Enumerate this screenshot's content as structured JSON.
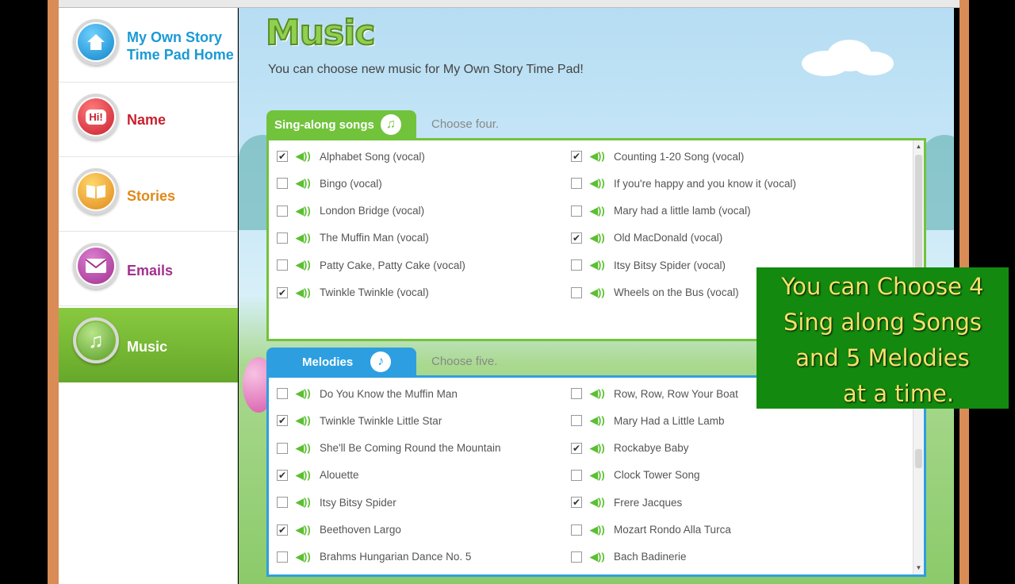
{
  "sidebar": {
    "items": [
      {
        "label_line1": "My Own Story",
        "label_line2": "Time Pad Home",
        "icon": "home-icon",
        "color": "#1a9ad6"
      },
      {
        "label": "Name",
        "icon": "hi-speech-icon",
        "icon_text": "Hi!",
        "color": "#c8202e"
      },
      {
        "label": "Stories",
        "icon": "book-icon",
        "color": "#e08a1a"
      },
      {
        "label": "Emails",
        "icon": "envelope-icon",
        "color": "#a2318f"
      },
      {
        "label": "Music",
        "icon": "music-note-icon",
        "color": "#ffffff",
        "active": true
      }
    ]
  },
  "main": {
    "title": "Music",
    "subtitle": "You can choose new music for My Own Story Time Pad!"
  },
  "sing_along": {
    "tab_label": "Sing-along songs",
    "choose_text": "Choose four.",
    "left": [
      {
        "label": "Alphabet Song (vocal)",
        "checked": true
      },
      {
        "label": "Bingo (vocal)",
        "checked": false
      },
      {
        "label": "London Bridge (vocal)",
        "checked": false
      },
      {
        "label": "The Muffin Man (vocal)",
        "checked": false
      },
      {
        "label": "Patty Cake, Patty Cake (vocal)",
        "checked": false
      },
      {
        "label": "Twinkle Twinkle (vocal)",
        "checked": true
      }
    ],
    "right": [
      {
        "label": "Counting 1-20 Song (vocal)",
        "checked": true
      },
      {
        "label": "If you're happy and you know it (vocal)",
        "checked": false
      },
      {
        "label": "Mary had a little lamb (vocal)",
        "checked": false
      },
      {
        "label": "Old MacDonald (vocal)",
        "checked": true
      },
      {
        "label": "Itsy Bitsy Spider (vocal)",
        "checked": false
      },
      {
        "label": "Wheels on the Bus (vocal)",
        "checked": false
      }
    ]
  },
  "melodies": {
    "tab_label": "Melodies",
    "choose_text": "Choose five.",
    "left": [
      {
        "label": "Do You Know the Muffin Man",
        "checked": false
      },
      {
        "label": "Twinkle Twinkle Little Star",
        "checked": true
      },
      {
        "label": "She'll Be Coming Round the Mountain",
        "checked": false
      },
      {
        "label": "Alouette",
        "checked": true
      },
      {
        "label": "Itsy Bitsy Spider",
        "checked": false
      },
      {
        "label": "Beethoven Largo",
        "checked": true
      },
      {
        "label": "Brahms Hungarian Dance No. 5",
        "checked": false
      }
    ],
    "right": [
      {
        "label": "Row, Row, Row Your Boat",
        "checked": false
      },
      {
        "label": "Mary Had a Little Lamb",
        "checked": false
      },
      {
        "label": "Rockabye Baby",
        "checked": true
      },
      {
        "label": "Clock Tower Song",
        "checked": false
      },
      {
        "label": "Frere Jacques",
        "checked": true
      },
      {
        "label": "Mozart Rondo Alla Turca",
        "checked": false
      },
      {
        "label": "Bach Badinerie",
        "checked": false
      }
    ]
  },
  "overlay": {
    "lines": [
      "You can Choose 4",
      "Sing along Songs",
      "and 5 Melodies",
      "at a time."
    ]
  }
}
